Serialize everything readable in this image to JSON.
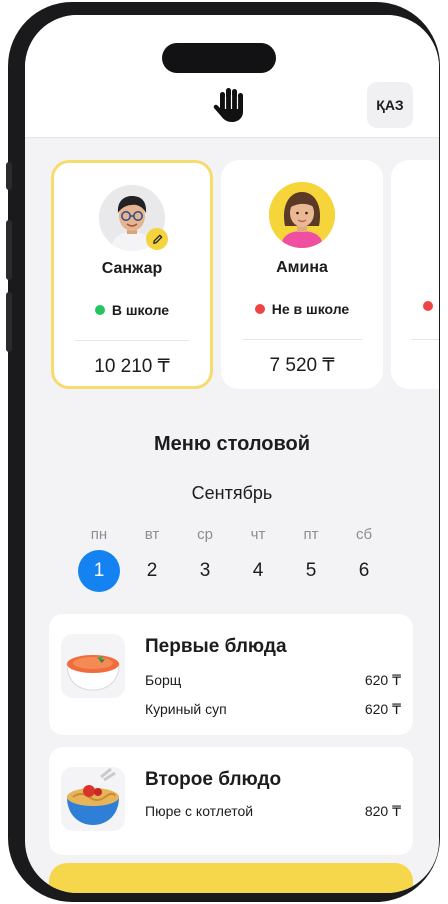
{
  "header": {
    "logo_icon": "raised-hand-icon",
    "language_label": "ҚАЗ"
  },
  "children": [
    {
      "name": "Санжар",
      "status": "В школе",
      "status_color": "#22c55e",
      "balance": "10 210 ₸",
      "selected": true
    },
    {
      "name": "Амина",
      "status": "Не в школе",
      "status_color": "#ef4444",
      "balance": "7 520 ₸",
      "selected": false
    }
  ],
  "menu": {
    "title": "Меню столовой",
    "month": "Сентябрь",
    "days": [
      {
        "weekday": "пн",
        "number": "1",
        "active": true
      },
      {
        "weekday": "вт",
        "number": "2"
      },
      {
        "weekday": "ср",
        "number": "3"
      },
      {
        "weekday": "чт",
        "number": "4"
      },
      {
        "weekday": "пт",
        "number": "5"
      },
      {
        "weekday": "сб",
        "number": "6"
      }
    ],
    "sections": [
      {
        "title": "Первые блюда",
        "icon": "soup-bowl-icon",
        "items": [
          {
            "name": "Борщ",
            "price": "620 ₸"
          },
          {
            "name": "Куриный суп",
            "price": "620 ₸"
          }
        ]
      },
      {
        "title": "Второе блюдо",
        "icon": "noodle-bowl-icon",
        "items": [
          {
            "name": "Пюре с котлетой",
            "price": "820 ₸"
          }
        ]
      }
    ]
  },
  "colors": {
    "accent_yellow": "#f6d64a",
    "selected_border": "#f6dc6f",
    "active_day": "#1482f0"
  }
}
